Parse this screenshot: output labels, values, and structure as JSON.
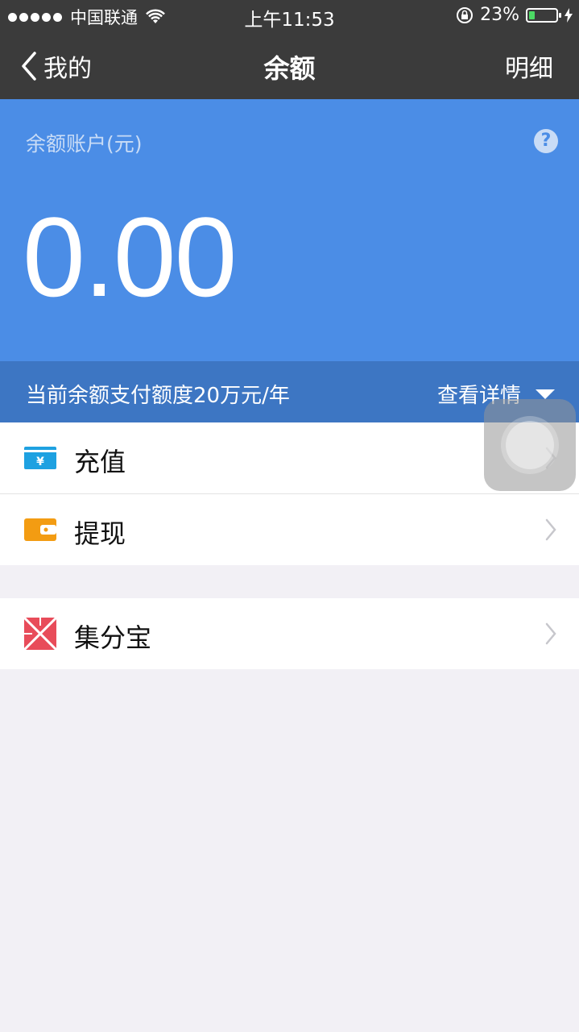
{
  "status_bar": {
    "carrier": "中国联通",
    "time": "上午11:53",
    "battery_pct": "23%",
    "battery_level": 0.23
  },
  "nav": {
    "back_label": "我的",
    "title": "余额",
    "right_label": "明细"
  },
  "balance": {
    "account_label": "余额账户(元)",
    "help_icon": "?",
    "amount": "0.00"
  },
  "quota": {
    "text": "当前余额支付额度20万元/年",
    "link": "查看详情"
  },
  "menu": {
    "recharge": "充值",
    "withdraw": "提现",
    "jifenbao": "集分宝"
  },
  "icons": {
    "recharge": "yuan-card-icon",
    "withdraw": "wallet-icon",
    "jifenbao": "jifenbao-icon"
  },
  "colors": {
    "nav_bg": "#3b3b3b",
    "hero_bg": "#4b8de6",
    "quota_bg": "#3d76c3",
    "recharge_icon": "#1ea1e1",
    "withdraw_icon": "#f39c12",
    "jifenbao_icon": "#e84c5a"
  }
}
